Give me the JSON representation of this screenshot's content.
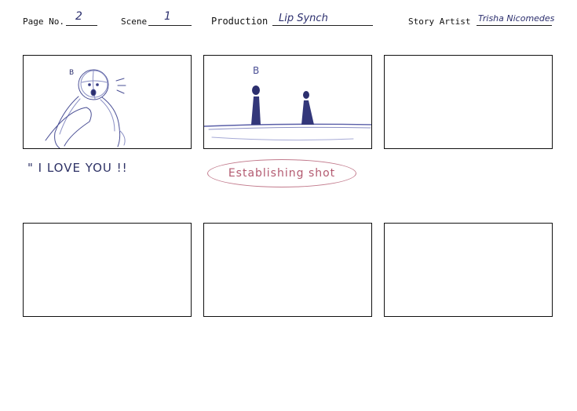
{
  "header": {
    "page_no_label": "Page No.",
    "page_no_value": "2",
    "scene_label": "Scene",
    "scene_value": "1",
    "production_label": "Production",
    "production_value": "Lip Synch",
    "story_artist_label": "Story Artist",
    "story_artist_value": "Trisha Nicomedes"
  },
  "panels": {
    "p1": {
      "sketch": "character-closeup",
      "letter": "B",
      "caption": "\" I LOVE YOU !!"
    },
    "p2": {
      "sketch": "two-figures-on-ground",
      "letter": "B",
      "caption": "Establishing shot"
    },
    "p3": {
      "sketch": ""
    },
    "p4": {
      "sketch": ""
    },
    "p5": {
      "sketch": ""
    },
    "p6": {
      "sketch": ""
    }
  },
  "colors": {
    "sketch_ink": "#2c2f6e",
    "sketch_light": "#8a8fc4",
    "caption_oval": "#c27a8c",
    "caption_text": "#b35a70"
  }
}
